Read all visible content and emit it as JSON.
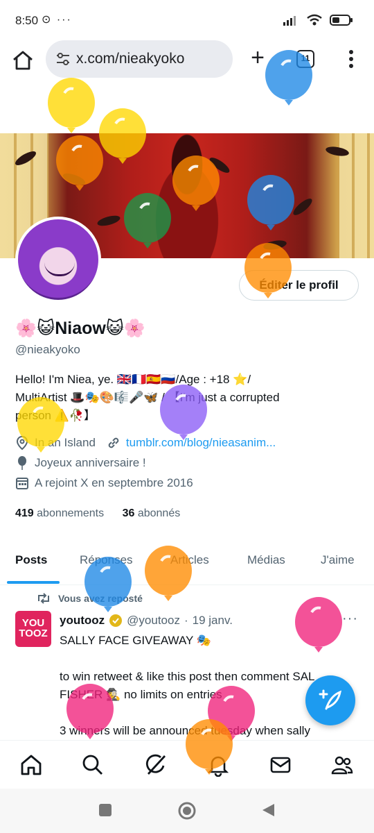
{
  "status_bar": {
    "time": "8:50",
    "left_icons": "⊙ ···"
  },
  "browser": {
    "url": "x.com/nieakyoko",
    "tab_count": "11"
  },
  "profile": {
    "display_name": "🌸😺Niaow😺🌸",
    "handle": "@nieakyoko",
    "edit_button": "Éditer le profil",
    "bio_line1": "Hello! I'm Niea, ye. 🇬🇧🇫🇷🇪🇸🇷🇺/Age : +18 ⭐/",
    "bio_line2": "MultiArtist 🎩🎭🎨🎼🎤🦋 / 【I'm just a corrupted",
    "bio_line3": "person ⚠️🥀】",
    "location": "In an Island",
    "link": "tumblr.com/blog/nieasanim...",
    "birthday": "Joyeux anniversaire !",
    "joined": "A rejoint X en septembre 2016",
    "following_count": "419",
    "following_label": "abonnements",
    "followers_count": "36",
    "followers_label": "abonnés"
  },
  "tabs": [
    "Posts",
    "Réponses",
    "Articles",
    "Médias",
    "J'aime"
  ],
  "post": {
    "repost_label": "Vous avez reposté",
    "avatar_text": "YOU TOOZ",
    "author": "youtooz",
    "author_handle": "@youtooz",
    "dot": "·",
    "date": "19 janv.",
    "line1": "SALLY FACE GIVEAWAY 🎭",
    "line2": "to win retweet & like this post then comment SAL",
    "line3": "FISHER 🕵️ no limits on entries",
    "line4": "3 winners will be announced tuesday when sally"
  },
  "icons": {
    "home": "home-icon",
    "search": "search-icon",
    "grok": "grok-icon",
    "notifications": "bell-icon",
    "messages": "mail-icon",
    "communities": "people-icon"
  },
  "colors": {
    "accent": "#1d9bf0",
    "text": "#0f1419",
    "muted": "#536471"
  }
}
